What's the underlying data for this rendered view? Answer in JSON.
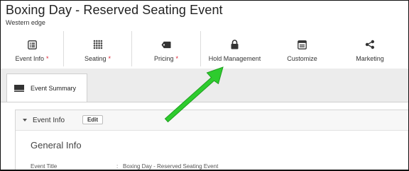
{
  "event": {
    "title": "Boxing Day - Reserved Seating Event",
    "venue": "Western edge"
  },
  "tabs": [
    {
      "label": "Event Info",
      "required": "*",
      "icon": "list-icon"
    },
    {
      "label": "Seating",
      "required": "*",
      "icon": "seat-grid-icon"
    },
    {
      "label": "Pricing",
      "required": "*",
      "icon": "price-tag-icon"
    },
    {
      "label": "Hold Management",
      "required": "",
      "icon": "lock-icon"
    },
    {
      "label": "Customize",
      "required": "",
      "icon": "window-icon"
    },
    {
      "label": "Marketing",
      "required": "",
      "icon": "share-icon"
    }
  ],
  "subtab": {
    "label": "Event Summary",
    "icon": "monitor-icon"
  },
  "section": {
    "title": "Event Info",
    "edit_label": "Edit",
    "general_title": "General Info",
    "fields": [
      {
        "label": "Event Title",
        "separator": ":",
        "value": "Boxing Day - Reserved Seating Event"
      }
    ]
  },
  "colors": {
    "required": "#dd2233",
    "arrow": "#2ecc2e"
  }
}
